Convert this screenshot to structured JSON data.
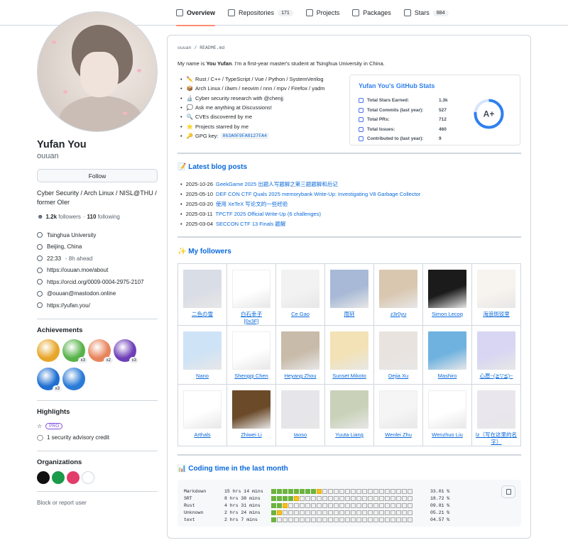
{
  "tabs": [
    {
      "label": "Overview",
      "count": ""
    },
    {
      "label": "Repositories",
      "count": "171"
    },
    {
      "label": "Projects",
      "count": ""
    },
    {
      "label": "Packages",
      "count": ""
    },
    {
      "label": "Stars",
      "count": "884"
    }
  ],
  "profile": {
    "name": "Yufan You",
    "login": "ouuan",
    "follow_label": "Follow",
    "bio": "Cyber Security / Arch Linux / NISL@THU / former OIer",
    "followers_count": "1.2k",
    "followers_label": "followers",
    "dot": "·",
    "following_count": "110",
    "following_label": "following",
    "details": [
      {
        "icon": "organization-icon",
        "text": "Tsinghua University"
      },
      {
        "icon": "location-icon",
        "text": "Beijing, China"
      },
      {
        "icon": "clock-icon",
        "text": "22:33",
        "extra": " - 8h ahead"
      },
      {
        "icon": "link-icon",
        "text": "https://ouuan.moe/about"
      },
      {
        "icon": "orcid-icon",
        "text": "https://orcid.org/0009-0004-2975-2107"
      },
      {
        "icon": "mastodon-icon",
        "text": "@ouuan@mastodon.online"
      },
      {
        "icon": "link-icon",
        "text": "https://yufan.you/"
      }
    ],
    "achievements_title": "Achievements",
    "achievements": [
      {
        "color": "#e7a62a",
        "mult": ""
      },
      {
        "color": "#58b24a",
        "mult": "x3"
      },
      {
        "color": "#e8845c",
        "mult": "x2"
      },
      {
        "color": "#6e3fb8",
        "mult": "x3"
      },
      {
        "color": "#1f6fd1",
        "mult": "x3"
      },
      {
        "color": "#2a7bd6",
        "mult": ""
      }
    ],
    "highlights_title": "Highlights",
    "pro_label": "PRO",
    "advisory_label": "1 security advisory credit",
    "organizations_title": "Organizations",
    "org_colors": [
      "#111111",
      "#1a9a4a",
      "#e23c6a",
      "#ffffff"
    ],
    "block_label": "Block or report user"
  },
  "readme": {
    "path_owner": "ouuan",
    "path_sep": " / ",
    "path_file": "README",
    "path_ext": ".md",
    "intro_pre": "My name is ",
    "intro_name": "You Yufan",
    "intro_post": ". I'm a first-year master's student at Tsinghua University in China.",
    "bullets": [
      {
        "emoji": "✏️",
        "text": "Rust / C++ / TypeScript / Vue / Python / SystemVerilog"
      },
      {
        "emoji": "📦",
        "text": "Arch Linux / i3wm / neovim / nnn / mpv / Firefox / yadm"
      },
      {
        "emoji": "🔬",
        "text": "Cyber security research with @chenjj"
      },
      {
        "emoji": "💭",
        "text": "Ask me anything at Discussions!"
      },
      {
        "emoji": "🔍",
        "text": "CVEs discovered by me"
      },
      {
        "emoji": "⭐",
        "text": "Projects starred by me"
      },
      {
        "emoji": "🔑",
        "text": "GPG key: ",
        "code": "863A0F9FA8127FA4"
      }
    ],
    "stats": {
      "title": "Yufan You's GitHub Stats",
      "rows": [
        {
          "label": "Total Stars Earned:",
          "value": "1.3k"
        },
        {
          "label": "Total Commits (last year):",
          "value": "527"
        },
        {
          "label": "Total PRs:",
          "value": "712"
        },
        {
          "label": "Total Issues:",
          "value": "460"
        },
        {
          "label": "Contributed to (last year):",
          "value": "9"
        }
      ],
      "grade": "A+",
      "ring_color": "#2f80ed"
    },
    "blog_title": "📝 Latest blog posts",
    "posts": [
      {
        "date": "2025-10-26",
        "title": "GeekGame 2025 出题人写题解之第三题题解和后记"
      },
      {
        "date": "2025-05-10",
        "title": "DEF CON CTF Quals 2025 memorybank Write-Up: Investigating V8 Garbage Collector"
      },
      {
        "date": "2025-03-20",
        "title": "使用 XeTeX 写论文的一些经验"
      },
      {
        "date": "2025-03-11",
        "title": "TPCTF 2025 Official Write-Up (6 challenges)"
      },
      {
        "date": "2025-03-04",
        "title": "SECCON CTF 13 Finals 题解"
      }
    ],
    "followers_title": "✨ My followers",
    "followers": [
      [
        {
          "name": "二色の雪",
          "color": "#d9dde6"
        },
        {
          "name": "白石幸子\n[0x3F]",
          "color": "#ffffff"
        },
        {
          "name": "Ce Gao",
          "color": "#f2f2f2"
        },
        {
          "name": "雨轩",
          "color": "#a7b9d6"
        },
        {
          "name": "z3r0yu",
          "color": "#d9c7b0"
        },
        {
          "name": "Simon Lecoq",
          "color": "#1b1b1b"
        },
        {
          "name": "海浪斑驳里",
          "color": "#f7f3ee"
        }
      ],
      [
        {
          "name": "Nano",
          "color": "#cfe3f6"
        },
        {
          "name": "Shengqi Chen",
          "color": "#ffffff"
        },
        {
          "name": "Heyang Zhou",
          "color": "#c8bba9"
        },
        {
          "name": "Sunset Mikoto",
          "color": "#f3e2b6"
        },
        {
          "name": "Dejia Xu",
          "color": "#e9e3df"
        },
        {
          "name": "Mashiro",
          "color": "#6fb2e0"
        },
        {
          "name": "心愿~(≧▽≦)~",
          "color": "#d8d6f2"
        }
      ],
      [
        {
          "name": "Arthals",
          "color": "#ffffff"
        },
        {
          "name": "Zhiwei Li",
          "color": "#6b4a2a"
        },
        {
          "name": "taoso",
          "color": "#e6e6ea"
        },
        {
          "name": "Yuuta Liang",
          "color": "#c9d2b9"
        },
        {
          "name": "Wenlei Zhu",
          "color": "#f5f5f5"
        },
        {
          "name": "Wenzhuo Liu",
          "color": "#ffffff"
        },
        {
          "name": "lz（写在这里的名字）",
          "color": "#e9e6ee"
        }
      ]
    ],
    "coding_title": "📊 Coding time in the last month",
    "coding": [
      {
        "lang": "Markdown",
        "time": "15 hrs 14 mins",
        "pct": "33.01 %",
        "green": 8,
        "yellow": 1
      },
      {
        "lang": "SRT",
        "time": "8 hrs 38 mins",
        "pct": "18.72 %",
        "green": 4,
        "yellow": 1
      },
      {
        "lang": "Rust",
        "time": "4 hrs 31 mins",
        "pct": "09.81 %",
        "green": 2,
        "yellow": 1
      },
      {
        "lang": "Unknown",
        "time": "2 hrs 24 mins",
        "pct": "05.21 %",
        "green": 1,
        "yellow": 1
      },
      {
        "lang": "text",
        "time": "2 hrs 7 mins",
        "pct": "04.57 %",
        "green": 1,
        "yellow": 0
      }
    ]
  }
}
